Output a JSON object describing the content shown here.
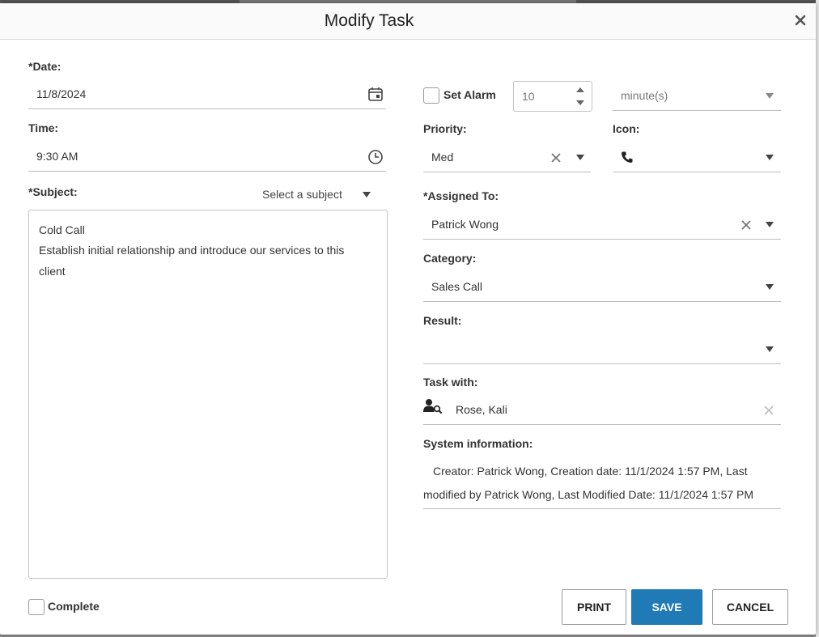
{
  "dialog": {
    "title": "Modify Task"
  },
  "date": {
    "label": "*Date:",
    "value": "11/8/2024"
  },
  "time": {
    "label": "Time:",
    "value": "9:30 AM"
  },
  "subject": {
    "label": "*Subject:",
    "select_placeholder": "Select a subject",
    "lines": [
      "Cold Call",
      "Establish initial relationship and introduce our services to this",
      "client"
    ]
  },
  "alarm": {
    "label": "Set Alarm",
    "amount": "10",
    "unit": "minute(s)",
    "checked": false
  },
  "priority": {
    "label": "Priority:",
    "value": "Med"
  },
  "icon": {
    "label": "Icon:",
    "value": "phone-icon"
  },
  "assigned_to": {
    "label": "*Assigned To:",
    "value": "Patrick Wong"
  },
  "category": {
    "label": "Category:",
    "value": "Sales Call"
  },
  "result": {
    "label": "Result:",
    "value": ""
  },
  "task_with": {
    "label": "Task with:",
    "value": "Rose, Kali"
  },
  "system_info": {
    "label": "System information:",
    "line1": "Creator: Patrick Wong, Creation date: 11/1/2024 1:57 PM, Last",
    "line2": "modified by Patrick Wong, Last Modified Date: 11/1/2024 1:57 PM"
  },
  "complete": {
    "label": "Complete",
    "checked": false
  },
  "buttons": {
    "print": "PRINT",
    "save": "SAVE",
    "cancel": "CANCEL"
  },
  "colors": {
    "primary": "#1f7ab5"
  }
}
